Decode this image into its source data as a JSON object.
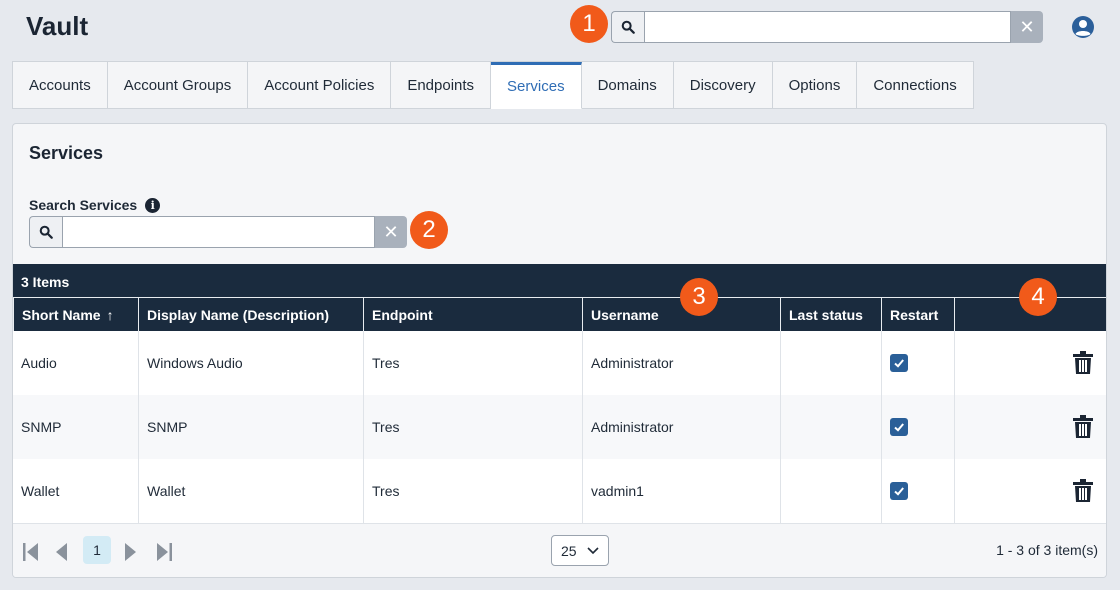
{
  "app": {
    "title": "Vault"
  },
  "badges": [
    "1",
    "2",
    "3",
    "4"
  ],
  "global_search": {
    "value": "",
    "placeholder": "",
    "clear_label": "✕"
  },
  "tabs": [
    {
      "label": "Accounts",
      "active": false
    },
    {
      "label": "Account Groups",
      "active": false
    },
    {
      "label": "Account Policies",
      "active": false
    },
    {
      "label": "Endpoints",
      "active": false
    },
    {
      "label": "Services",
      "active": true
    },
    {
      "label": "Domains",
      "active": false
    },
    {
      "label": "Discovery",
      "active": false
    },
    {
      "label": "Options",
      "active": false
    },
    {
      "label": "Connections",
      "active": false
    }
  ],
  "panel": {
    "title": "Services",
    "search_label": "Search Services",
    "search_value": "",
    "search_placeholder": "",
    "info_glyph": "i",
    "clear_label": "✕"
  },
  "grid": {
    "items_count": "3 Items",
    "columns": [
      "Short Name",
      "Display Name (Description)",
      "Endpoint",
      "Username",
      "Last status",
      "Restart",
      ""
    ],
    "sort_indicator": "↑",
    "rows": [
      {
        "short_name": "Audio",
        "display_name": "Windows Audio",
        "endpoint": "Tres",
        "username": "Administrator",
        "last_status": "",
        "restart": true
      },
      {
        "short_name": "SNMP",
        "display_name": "SNMP",
        "endpoint": "Tres",
        "username": "Administrator",
        "last_status": "",
        "restart": true
      },
      {
        "short_name": "Wallet",
        "display_name": "Wallet",
        "endpoint": "Tres",
        "username": "vadmin1",
        "last_status": "",
        "restart": true
      }
    ]
  },
  "pager": {
    "current_page": "1",
    "page_size": "25",
    "info": "1 - 3 of 3 item(s)"
  },
  "colors": {
    "accent": "#2f6db5",
    "header_bg": "#1a2b3e",
    "badge": "#f15a1a",
    "check": "#2a5f98"
  }
}
